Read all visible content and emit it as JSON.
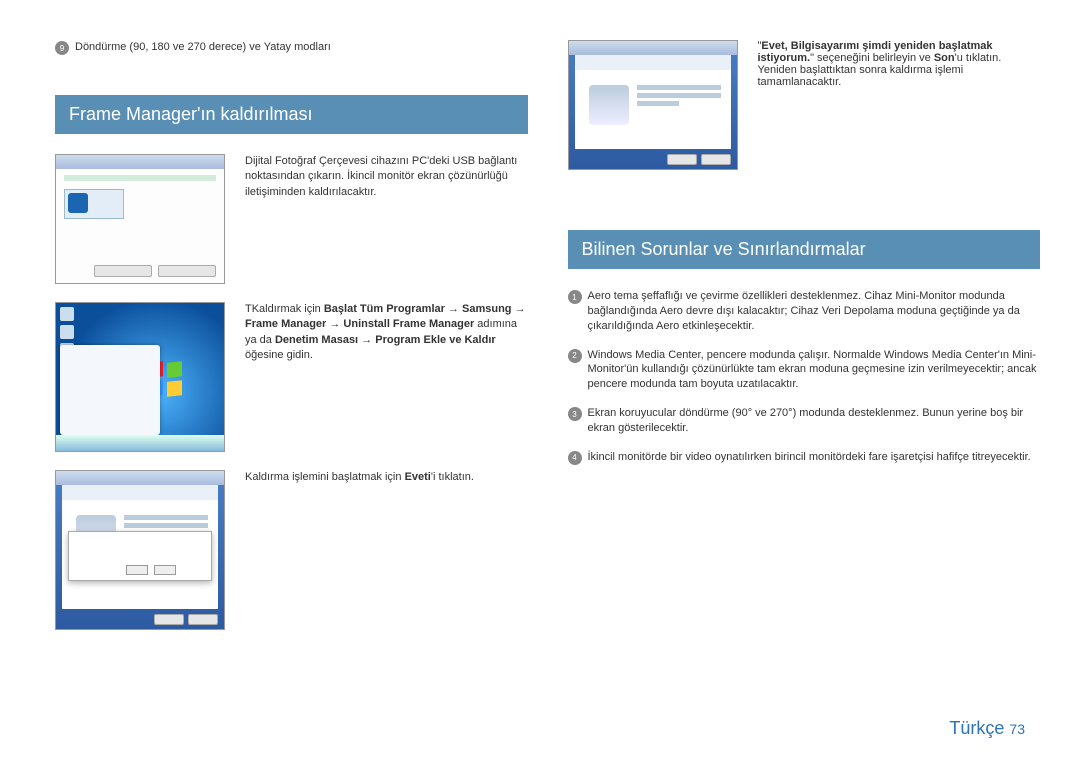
{
  "left": {
    "rotation_bullet_num": "9",
    "rotation_text": "Döndürme (90, 180 ve 270 derece) ve Yatay modları",
    "heading": "Frame Manager'ın kaldırılması",
    "step1_text": "Dijital Fotoğraf Çerçevesi cihazını PC'deki USB bağlantı noktasından çıkarın. İkincil monitör ekran çözünürlüğü iletişiminden kaldırılacaktır.",
    "step2_prefix": "TKaldırmak için ",
    "step2_bold_path": "Başlat Tüm Programlar → Samsung → Frame Manager → Uninstall Frame Manager",
    "step2_mid": " adımına ya da ",
    "step2_bold_path2": "Denetim Masası → Program Ekle ve Kaldır",
    "step2_suffix": " öğesine gidin.",
    "step3_prefix": "Kaldırma işlemini başlatmak için ",
    "step3_bold": "Eveti",
    "step3_suffix": "'i tıklatın."
  },
  "right": {
    "top_quote_open": "\"",
    "top_bold": "Evet, Bilgisayarımı şimdi yeniden başlatmak istiyorum.",
    "top_mid": "\" seçeneğini belirleyin ve ",
    "top_bold2": "Son",
    "top_suffix": "'u tıklatın. Yeniden başlattıktan sonra kaldırma işlemi tamamlanacaktır.",
    "heading": "Bilinen Sorunlar ve Sınırlandırmalar",
    "issues": [
      {
        "n": "1",
        "t": "Aero tema şeffaflığı ve çevirme özellikleri desteklenmez. Cihaz Mini-Monitor modunda bağlandığında Aero devre dışı kalacaktır; Cihaz Veri Depolama moduna geçtiğinde ya da çıkarıldığında Aero etkinleşecektir."
      },
      {
        "n": "2",
        "t": "Windows Media Center, pencere modunda çalışır. Normalde Windows Media Center'ın Mini-Monitor'ün kullandığı çözünürlükte tam ekran moduna geçmesine izin verilmeyecektir; ancak pencere modunda tam boyuta uzatılacaktır."
      },
      {
        "n": "3",
        "t": "Ekran koruyucular döndürme (90° ve 270°) modunda desteklenmez. Bunun yerine boş bir ekran gösterilecektir."
      },
      {
        "n": "4",
        "t": "İkincil monitörde bir video oynatılırken birincil monitördeki fare işaretçisi hafifçe titreyecektir."
      }
    ]
  },
  "footer": {
    "lang": "Türkçe",
    "page": "73"
  }
}
